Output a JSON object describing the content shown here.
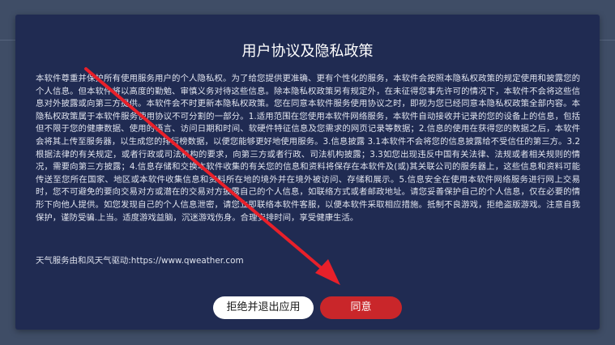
{
  "dialog": {
    "title": "用户协议及隐私政策",
    "body": "本软件尊重并保护所有使用服务用户的个人隐私权。为了给您提供更准确、更有个性化的服务，本软件会按照本隐私权政策的规定使用和披露您的个人信息。但本软件将以高度的勤勉、审慎义务对待这些信息。除本隐私权政策另有规定外，在未征得您事先许可的情况下，本软件不会将这些信息对外披露或向第三方提供。本软件会不时更新本隐私权政策。您在同意本软件服务使用协议之时，即视为您已经同意本隐私权政策全部内容。本隐私权政策属于本软件服务使用协议不可分割的一部分。1.适用范围在您使用本软件网络服务，本软件自动接收并记录的您的设备上的信息，包括但不限于您的健康数据、使用的语言、访问日期和时间、软硬件特征信息及您需求的网页记录等数据；2.信息的使用在获得您的数据之后，本软件会将其上传至服务器，以生成您的排行榜数据，以便您能够更好地使用服务。3.信息披露 3.1本软件不会将您的信息披露给不受信任的第三方。3.2 根据法律的有关规定，或者行政或司法机构的要求，向第三方或者行政、司法机构披露；3.3如您出现违反中国有关法律、法规或者相关规则的情况，需要向第三方披露；4.信息存储和交换本软件收集的有关您的信息和资料将保存在本软件及(或)其关联公司的服务器上，这些信息和资料可能传送至您所在国家、地区或本软件收集信息和资料所在地的境外并在境外被访问、存储和展示。5.信息安全在使用本软件网络服务进行网上交易时，您不可避免的要向交易对方或潜在的交易对方披露自己的个人信息，如联络方式或者邮政地址。请您妥善保护自己的个人信息，仅在必要的情形下向他人提供。如您发现自己的个人信息泄密，请您立即联络本软件客服，以便本软件采取相应措施。抵制不良游戏，拒绝盗版游戏。注意自我保护，谨防受骗.上当。适度游戏益脑，沉迷游戏伤身。合理安排时间，享受健康生活。",
    "weather_credit": "天气服务由和风天气驱动:https://www.qweather.com",
    "reject_label": "拒绝并退出应用",
    "agree_label": "同意"
  },
  "colors": {
    "background": "#3f4d66",
    "dialog": "#202b52",
    "agree_button": "#c9262a",
    "arrow": "#e8202a"
  }
}
